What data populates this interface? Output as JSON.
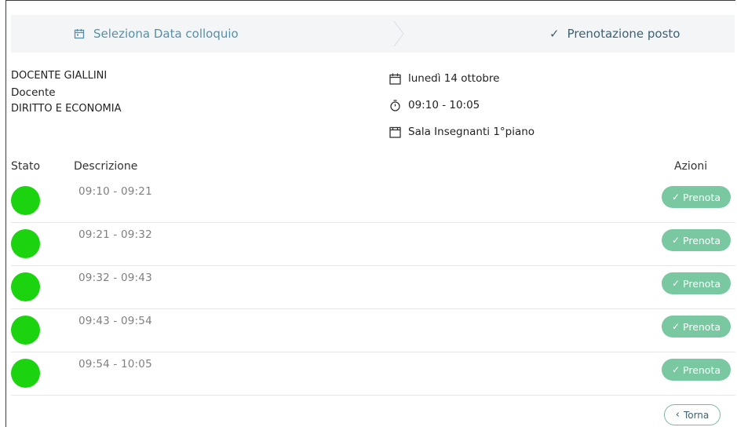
{
  "stepper": {
    "step1_label": "Seleziona Data colloquio",
    "step1_icon": "calendar-icon",
    "step2_label": "Prenotazione posto",
    "step2_icon": "check-icon",
    "separator_icon": "chevron-right-icon"
  },
  "teacher": {
    "name": "DOCENTE GIALLINI",
    "role": "Docente",
    "subject": "DIRITTO E ECONOMIA"
  },
  "meeting": {
    "date": "lunedì 14 ottobre",
    "time": "09:10 - 10:05",
    "room": "Sala Insegnanti 1°piano"
  },
  "table": {
    "headers": {
      "stato": "Stato",
      "descrizione": "Descrizione",
      "azioni": "Azioni"
    },
    "rows": [
      {
        "status_color": "#1bd40f",
        "description": "09:10 - 09:21",
        "action": "Prenota"
      },
      {
        "status_color": "#1bd40f",
        "description": "09:21 - 09:32",
        "action": "Prenota"
      },
      {
        "status_color": "#1bd40f",
        "description": "09:32 - 09:43",
        "action": "Prenota"
      },
      {
        "status_color": "#1bd40f",
        "description": "09:43 - 09:54",
        "action": "Prenota"
      },
      {
        "status_color": "#1bd40f",
        "description": "09:54 - 10:05",
        "action": "Prenota"
      }
    ]
  },
  "footer": {
    "back_label": "Torna"
  },
  "colors": {
    "accent": "#79c8a1",
    "status_available": "#1bd40f",
    "stepper_bg": "#f3f5f7"
  }
}
